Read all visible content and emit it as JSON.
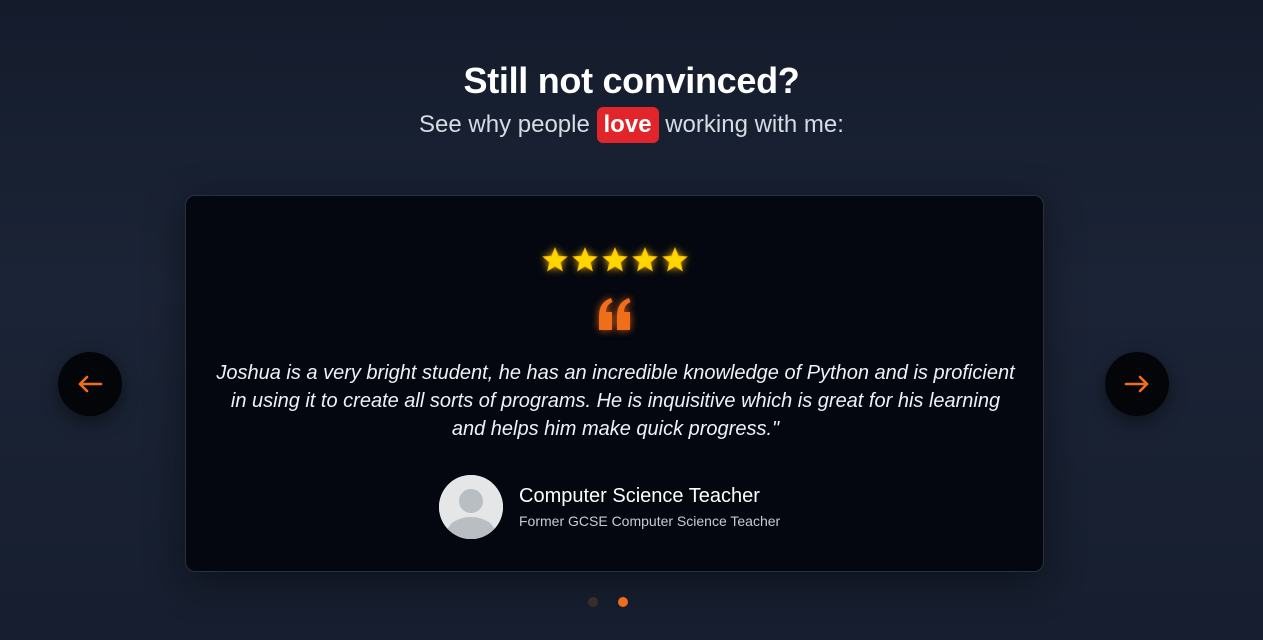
{
  "section": {
    "heading": "Still not convinced?",
    "subheading_before": "See why people ",
    "subheading_highlight": "love",
    "subheading_after": " working with me:"
  },
  "testimonial": {
    "rating": 5,
    "max_rating": 5,
    "quote": "Joshua is a very bright student, he has an incredible knowledge of Python and is proficient in using it to create all sorts of programs. He is inquisitive which is great for his learning and helps him make quick progress.\"",
    "author_name": "Computer Science Teacher",
    "author_role": "Former GCSE Computer Science Teacher",
    "avatar_icon": "default-user-avatar"
  },
  "navigation": {
    "prev_icon": "arrow-left-icon",
    "next_icon": "arrow-right-icon",
    "slide_count": 2,
    "active_index": 1
  },
  "colors": {
    "accent": "#f06e1a",
    "highlight_bg": "#e2252b",
    "star": "#ffd700",
    "card_bg": "#04070f",
    "page_bg": "#1b2436"
  }
}
